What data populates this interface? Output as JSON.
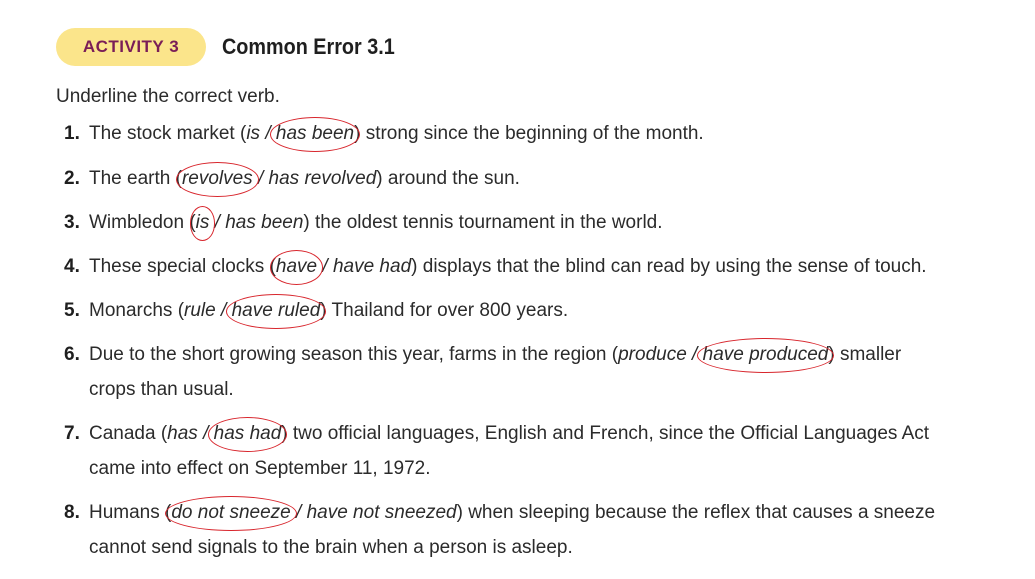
{
  "header": {
    "badge": "ACTIVITY 3",
    "title": "Common Error 3.1"
  },
  "instruction": "Underline the correct verb.",
  "items": [
    {
      "num": "1.",
      "pre": "The stock market (",
      "opt1": "is",
      "sep": " / ",
      "opt2": "has been",
      "post": ") strong since the beginning of the month.",
      "circled": 2
    },
    {
      "num": "2.",
      "pre": "The earth (",
      "opt1": "revolves",
      "sep": " / ",
      "opt2": "has revolved",
      "post": ") around the sun.",
      "circled": 1
    },
    {
      "num": "3.",
      "pre": "Wimbledon (",
      "opt1": "is",
      "sep": " / ",
      "opt2": "has been",
      "post": ") the oldest tennis tournament in the world.",
      "circled": 1
    },
    {
      "num": "4.",
      "pre": "These special clocks (",
      "opt1": "have",
      "sep": " / ",
      "opt2": "have had",
      "post": ") displays that the blind can read by using the sense of touch.",
      "circled": 1
    },
    {
      "num": "5.",
      "pre": "Monarchs (",
      "opt1": "rule",
      "sep": " / ",
      "opt2": "have ruled",
      "post": ") Thailand for over 800 years.",
      "circled": 2
    },
    {
      "num": "6.",
      "pre": "Due to the short growing season this year, farms in the region (",
      "opt1": "produce",
      "sep": " / ",
      "opt2": "have produced",
      "post": ") smaller",
      "cont": "crops than usual.",
      "circled": 2
    },
    {
      "num": "7.",
      "pre": "Canada (",
      "opt1": "has",
      "sep": " / ",
      "opt2": "has had",
      "post": ") two official languages, English and French, since the Official Languages Act",
      "cont": "came into effect on September 11, 1972.",
      "circled": 2
    },
    {
      "num": "8.",
      "pre": "Humans (",
      "opt1": "do not sneeze",
      "sep": " / ",
      "opt2": "have not sneezed",
      "post": ") when sleeping because the reflex that causes a sneeze",
      "cont": "cannot send signals to the brain when a person is asleep.",
      "circled": 1
    }
  ]
}
